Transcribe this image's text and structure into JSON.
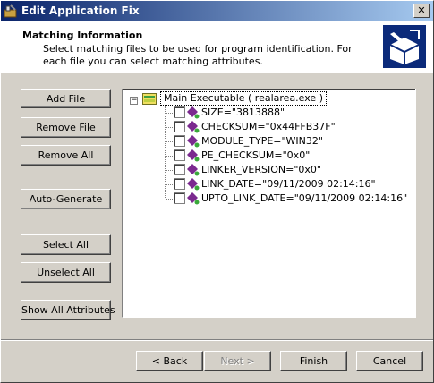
{
  "window": {
    "title": "Edit Application Fix"
  },
  "header": {
    "title": "Matching Information",
    "description": "Select matching files to be used for program identification. For each file you can select matching attributes."
  },
  "left_buttons": {
    "add_file": "Add File",
    "remove_file": "Remove File",
    "remove_all": "Remove All",
    "auto_generate": "Auto-Generate",
    "select_all": "Select All",
    "unselect_all": "Unselect All",
    "show_all_attributes": "Show All Attributes"
  },
  "tree": {
    "expander": "−",
    "root_label": "Main Executable ( realarea.exe )",
    "attributes": [
      {
        "label": "SIZE=\"3813888\"",
        "checked": false
      },
      {
        "label": "CHECKSUM=\"0x44FFB37F\"",
        "checked": false
      },
      {
        "label": "MODULE_TYPE=\"WIN32\"",
        "checked": false
      },
      {
        "label": "PE_CHECKSUM=\"0x0\"",
        "checked": false
      },
      {
        "label": "LINKER_VERSION=\"0x0\"",
        "checked": false
      },
      {
        "label": "LINK_DATE=\"09/11/2009 02:14:16\"",
        "checked": false
      },
      {
        "label": "UPTO_LINK_DATE=\"09/11/2009 02:14:16\"",
        "checked": false
      }
    ]
  },
  "footer": {
    "back": "< Back",
    "next": "Next >",
    "finish": "Finish",
    "cancel": "Cancel"
  },
  "colors": {
    "title_gradient_start": "#0a246a",
    "title_gradient_end": "#a6caf0",
    "face": "#d4d0c8",
    "attr_icon": "#7b2a8f"
  }
}
